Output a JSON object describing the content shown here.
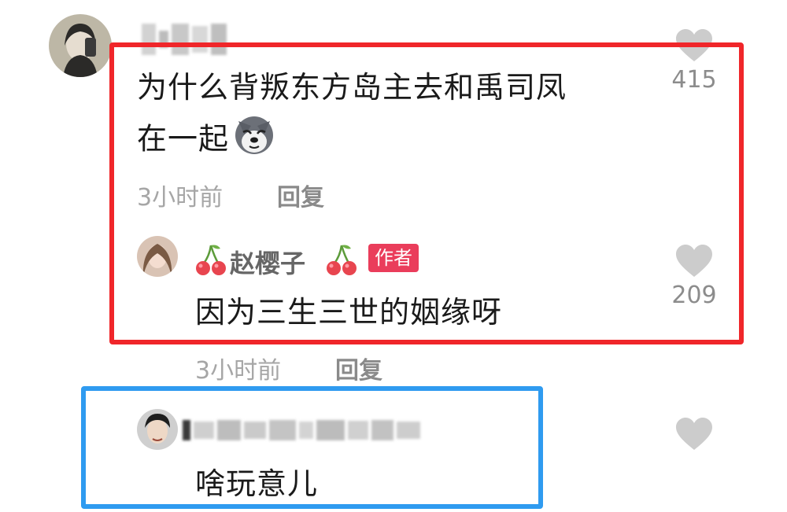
{
  "comment": {
    "text_line1": "为什么背叛东方岛主去和禹司凤",
    "text_line2": "在一起",
    "emoji_icon": "husky-dog-emoji",
    "time": "3小时前",
    "reply_label": "回复",
    "likes": "415"
  },
  "reply": {
    "username": "赵樱子",
    "name_decoration_icon": "cherry-icon",
    "badge": "作者",
    "text": "因为三生三世的姻缘呀",
    "time": "3小时前",
    "reply_label": "回复",
    "likes": "209"
  },
  "reply2": {
    "text": "啥玩意儿"
  },
  "colors": {
    "highlight_red": "#f0262a",
    "highlight_blue": "#2f9bf0",
    "badge_bg": "#ea3d5b",
    "heart_gray": "#cccccc"
  }
}
